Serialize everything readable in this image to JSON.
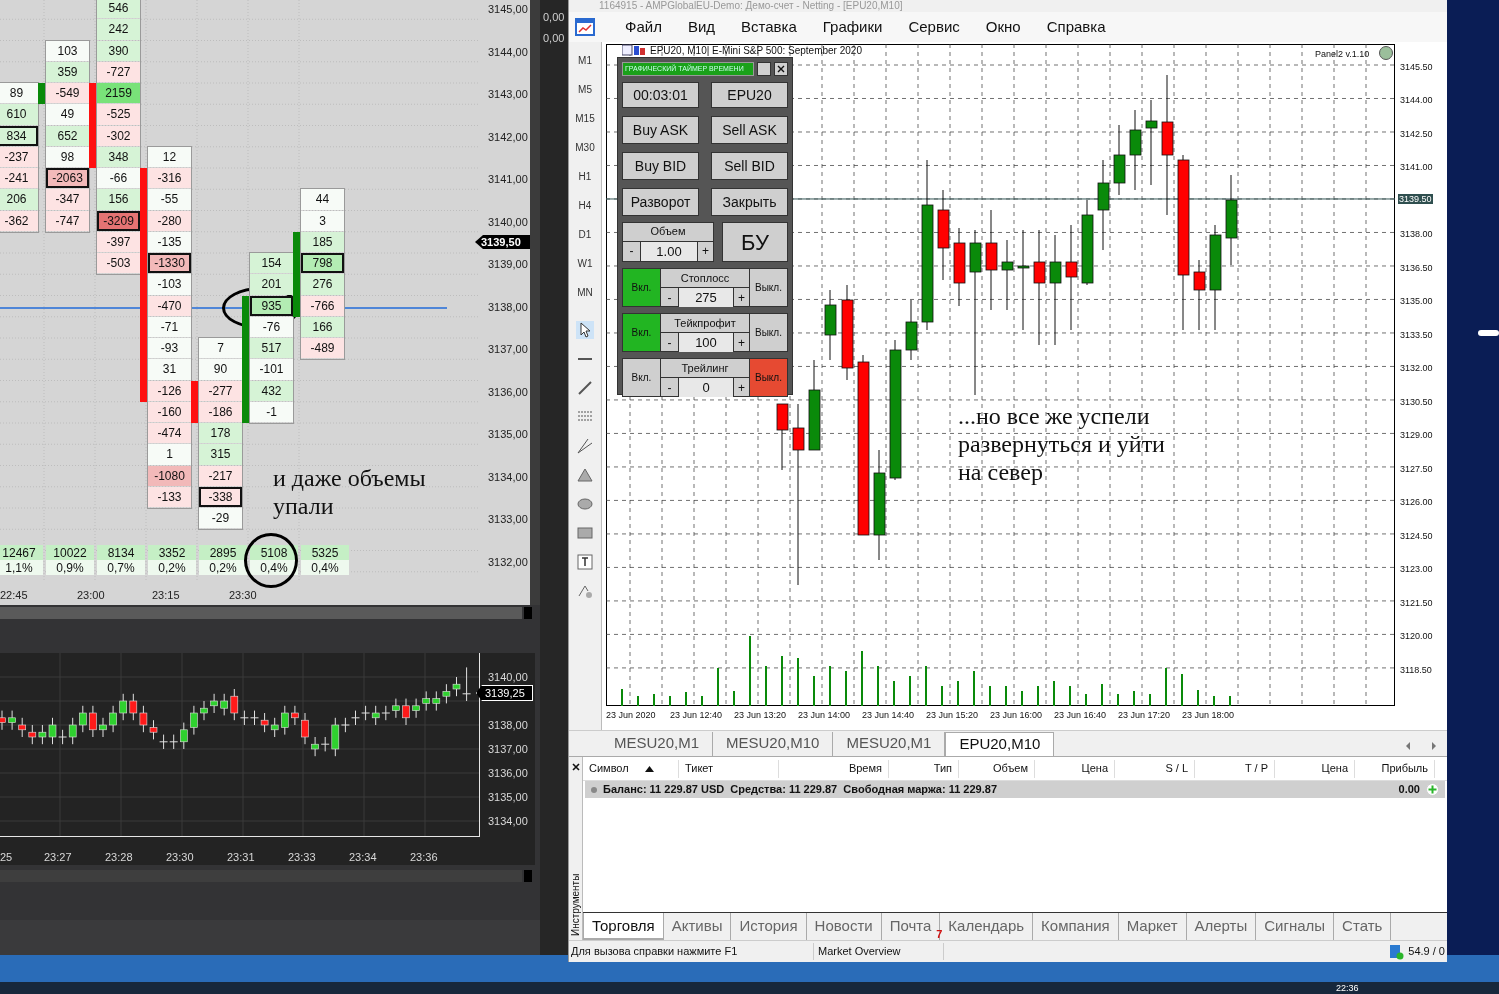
{
  "footprint": {
    "columns": [
      {
        "cells": [
          {
            "value": "89",
            "color": "#f7fbf7",
            "boxed": false,
            "in_body": false
          },
          {
            "value": "610",
            "color": "#d6f3d6",
            "boxed": false,
            "in_body": false
          },
          {
            "value": "834",
            "color": "#d6f3d6",
            "boxed": true,
            "in_body": false
          },
          {
            "value": "-237",
            "color": "#fde3e3",
            "boxed": false,
            "in_body": false
          },
          {
            "value": "-241",
            "color": "#fde3e3",
            "boxed": false,
            "in_body": false
          },
          {
            "value": "206",
            "color": "#d6f3d6",
            "boxed": false,
            "in_body": false
          },
          {
            "value": "-362",
            "color": "#fde3e3",
            "boxed": false,
            "in_body": false
          }
        ],
        "volume": "12467",
        "percent": "1,1%"
      },
      {
        "body": {
          "color": "#0a8a0a"
        },
        "cells": [
          {
            "value": "103",
            "color": "#f7fbf7",
            "boxed": false,
            "in_body": false
          },
          {
            "value": "359",
            "color": "#d6f3d6",
            "boxed": false,
            "in_body": false
          },
          {
            "value": "-549",
            "color": "#fde3e3",
            "boxed": false,
            "in_body": true
          },
          {
            "value": "49",
            "color": "#f7fbf7",
            "boxed": false,
            "in_body": false
          },
          {
            "value": "652",
            "color": "#d6f3d6",
            "boxed": false,
            "in_body": false
          },
          {
            "value": "98",
            "color": "#f7fbf7",
            "boxed": false,
            "in_body": false
          },
          {
            "value": "-2063",
            "color": "#f2b9b9",
            "boxed": true,
            "in_body": false
          },
          {
            "value": "-347",
            "color": "#fde3e3",
            "boxed": false,
            "in_body": false
          },
          {
            "value": "-747",
            "color": "#fde3e3",
            "boxed": false,
            "in_body": false
          }
        ],
        "volume": "10022",
        "percent": "0,9%"
      },
      {
        "body": {
          "color": "#ff1010"
        },
        "cells": [
          {
            "value": "546",
            "color": "#d6f3d6",
            "boxed": false,
            "in_body": false
          },
          {
            "value": "242",
            "color": "#d6f3d6",
            "boxed": false,
            "in_body": false
          },
          {
            "value": "390",
            "color": "#d6f3d6",
            "boxed": false,
            "in_body": false
          },
          {
            "value": "-727",
            "color": "#fde3e3",
            "boxed": false,
            "in_body": false
          },
          {
            "value": "2159",
            "color": "#79e279",
            "boxed": false,
            "in_body": true
          },
          {
            "value": "-525",
            "color": "#fde3e3",
            "boxed": false,
            "in_body": true
          },
          {
            "value": "-302",
            "color": "#fde3e3",
            "boxed": false,
            "in_body": true
          },
          {
            "value": "348",
            "color": "#d6f3d6",
            "boxed": false,
            "in_body": true
          },
          {
            "value": "-66",
            "color": "#f7fbf7",
            "boxed": false,
            "in_body": false
          },
          {
            "value": "156",
            "color": "#d6f3d6",
            "boxed": false,
            "in_body": false
          },
          {
            "value": "-3209",
            "color": "#e57373",
            "boxed": true,
            "in_body": false
          },
          {
            "value": "-397",
            "color": "#fde3e3",
            "boxed": false,
            "in_body": false
          },
          {
            "value": "-503",
            "color": "#fde3e3",
            "boxed": false,
            "in_body": false
          }
        ],
        "volume": "8134",
        "percent": "0,7%"
      },
      {
        "body": {
          "color": "#ff1010"
        },
        "cells": [
          {
            "value": "12",
            "color": "#f7fbf7",
            "boxed": false,
            "in_body": false
          },
          {
            "value": "-316",
            "color": "#fde3e3",
            "boxed": false,
            "in_body": true
          },
          {
            "value": "-55",
            "color": "#f7fbf7",
            "boxed": false,
            "in_body": true
          },
          {
            "value": "-280",
            "color": "#fde3e3",
            "boxed": false,
            "in_body": true
          },
          {
            "value": "-135",
            "color": "#f7fbf7",
            "boxed": false,
            "in_body": true
          },
          {
            "value": "-1330",
            "color": "#f2b9b9",
            "boxed": true,
            "in_body": true
          },
          {
            "value": "-103",
            "color": "#f7fbf7",
            "boxed": false,
            "in_body": true
          },
          {
            "value": "-470",
            "color": "#fde3e3",
            "boxed": false,
            "in_body": true
          },
          {
            "value": "-71",
            "color": "#f7fbf7",
            "boxed": false,
            "in_body": true
          },
          {
            "value": "-93",
            "color": "#f7fbf7",
            "boxed": false,
            "in_body": true
          },
          {
            "value": "31",
            "color": "#f7fbf7",
            "boxed": false,
            "in_body": true
          },
          {
            "value": "-126",
            "color": "#fde3e3",
            "boxed": false,
            "in_body": true
          },
          {
            "value": "-160",
            "color": "#fde3e3",
            "boxed": false,
            "in_body": false
          },
          {
            "value": "-474",
            "color": "#fde3e3",
            "boxed": false,
            "in_body": false
          },
          {
            "value": "1",
            "color": "#f7fbf7",
            "boxed": false,
            "in_body": false
          },
          {
            "value": "-1080",
            "color": "#f2b9b9",
            "boxed": false,
            "in_body": false
          },
          {
            "value": "-133",
            "color": "#fde3e3",
            "boxed": false,
            "in_body": false
          }
        ],
        "volume": "3352",
        "percent": "0,2%"
      },
      {
        "body": {
          "color": "#ff1010"
        },
        "cells": [
          {
            "value": "7",
            "color": "#f7fbf7",
            "boxed": false,
            "in_body": false
          },
          {
            "value": "90",
            "color": "#f7fbf7",
            "boxed": false,
            "in_body": false
          },
          {
            "value": "-277",
            "color": "#fde3e3",
            "boxed": false,
            "in_body": true
          },
          {
            "value": "-186",
            "color": "#fde3e3",
            "boxed": false,
            "in_body": true
          },
          {
            "value": "178",
            "color": "#d6f3d6",
            "boxed": false,
            "in_body": false
          },
          {
            "value": "315",
            "color": "#d6f3d6",
            "boxed": false,
            "in_body": false
          },
          {
            "value": "-217",
            "color": "#fde3e3",
            "boxed": false,
            "in_body": false
          },
          {
            "value": "-338",
            "color": "#fde3e3",
            "boxed": true,
            "in_body": false
          },
          {
            "value": "-29",
            "color": "#f7fbf7",
            "boxed": false,
            "in_body": false
          }
        ],
        "volume": "2895",
        "percent": "0,2%"
      },
      {
        "body": {
          "color": "#0a8a0a"
        },
        "cells": [
          {
            "value": "154",
            "color": "#d6f3d6",
            "boxed": false,
            "in_body": false
          },
          {
            "value": "201",
            "color": "#d6f3d6",
            "boxed": false,
            "in_body": false
          },
          {
            "value": "935",
            "color": "#b3ecb3",
            "boxed": true,
            "in_body": true
          },
          {
            "value": "-76",
            "color": "#f7fbf7",
            "boxed": false,
            "in_body": true
          },
          {
            "value": "517",
            "color": "#d6f3d6",
            "boxed": false,
            "in_body": true
          },
          {
            "value": "-101",
            "color": "#f7fbf7",
            "boxed": false,
            "in_body": true
          },
          {
            "value": "432",
            "color": "#d6f3d6",
            "boxed": false,
            "in_body": true
          },
          {
            "value": "-1",
            "color": "#f7fbf7",
            "boxed": false,
            "in_body": true
          }
        ],
        "volume": "5108",
        "percent": "0,4%"
      },
      {
        "body": {
          "color": "#0a8a0a"
        },
        "cells": [
          {
            "value": "44",
            "color": "#f7fbf7",
            "boxed": false,
            "in_body": false
          },
          {
            "value": "3",
            "color": "#f7fbf7",
            "boxed": false,
            "in_body": false
          },
          {
            "value": "185",
            "color": "#d6f3d6",
            "boxed": false,
            "in_body": true
          },
          {
            "value": "798",
            "color": "#b3ecb3",
            "boxed": true,
            "in_body": true
          },
          {
            "value": "276",
            "color": "#d6f3d6",
            "boxed": false,
            "in_body": true
          },
          {
            "value": "-766",
            "color": "#fde3e3",
            "boxed": false,
            "in_body": true
          },
          {
            "value": "166",
            "color": "#d6f3d6",
            "boxed": false,
            "in_body": false
          },
          {
            "value": "-489",
            "color": "#fde3e3",
            "boxed": false,
            "in_body": false
          }
        ],
        "volume": "5325",
        "percent": "0,4%"
      }
    ],
    "price_axis": [
      "3145,00",
      "3144,00",
      "3143,00",
      "3142,00",
      "3141,00",
      "3140,00",
      "3139,00",
      "3138,00",
      "3137,00",
      "3136,00",
      "3135,00",
      "3134,00",
      "3133,00",
      "3132,00"
    ],
    "current_price": "3139,50",
    "time_axis": [
      "22:45",
      "23:00",
      "23:15",
      "23:30"
    ],
    "annotation": "и даже объемы упали"
  },
  "side_values": [
    "0,00",
    "0,00"
  ],
  "minute_chart": {
    "price_axis": [
      "3140,00",
      "3138,00",
      "3137,00",
      "3136,00",
      "3135,00",
      "3134,00"
    ],
    "current_price": "3139,25",
    "time_axis": [
      "25",
      "23:27",
      "23:28",
      "23:30",
      "23:31",
      "23:33",
      "23:34",
      "23:36"
    ]
  },
  "terminal": {
    "title": "1164915 - AMPGlobalEU-Demo: Демо-счет - Netting - [EPU20,M10]",
    "menu": [
      "Файл",
      "Вид",
      "Вставка",
      "Графики",
      "Сервис",
      "Окно",
      "Справка"
    ],
    "timeframes": [
      "M1",
      "M5",
      "M15",
      "M30",
      "H1",
      "H4",
      "D1",
      "W1",
      "MN"
    ],
    "chart": {
      "title": "EPU20, M10| E-Mini S&P 500: September 2020",
      "indicator_label": "Panel2 v.1.10",
      "price_axis": [
        "3145.50",
        "3144.00",
        "3142.50",
        "3141.00",
        "3138.00",
        "3136.50",
        "3135.00",
        "3133.50",
        "3132.00",
        "3130.50",
        "3129.00",
        "3127.50",
        "3126.00",
        "3124.50",
        "3123.00",
        "3121.50",
        "3120.00",
        "3118.50"
      ],
      "current_price": "3139.50",
      "time_axis": [
        "23 Jun 2020",
        "23 Jun 12:40",
        "23 Jun 13:20",
        "23 Jun 14:00",
        "23 Jun 14:40",
        "23 Jun 15:20",
        "23 Jun 16:00",
        "23 Jun 16:40",
        "23 Jun 17:20",
        "23 Jun 18:00"
      ],
      "annotation": "...но все же успели развернуться и уйти на север"
    },
    "panel": {
      "title": "ГРАФИЧЕСКИЙ ТАЙМЕР ВРЕМЕНИ",
      "timer": "00:03:01",
      "symbol": "EPU20",
      "buttons": [
        "Buy ASK",
        "Sell ASK",
        "Buy BID",
        "Sell BID",
        "Разворот",
        "Закрыть"
      ],
      "volume": {
        "label": "Объем",
        "minus": "-",
        "value": "1.00",
        "plus": "+"
      },
      "breakeven": "БУ",
      "toggles": [
        {
          "label": "Стоплосс",
          "on_label": "Вкл.",
          "off_label": "Выкл.",
          "minus": "-",
          "value": "275",
          "plus": "+",
          "on": true
        },
        {
          "label": "Тейкпрофит",
          "on_label": "Вкл.",
          "off_label": "Выкл.",
          "minus": "-",
          "value": "100",
          "plus": "+",
          "on": true
        },
        {
          "label": "Трейлинг",
          "on_label": "Вкл.",
          "off_label": "Выкл.",
          "minus": "-",
          "value": "0",
          "plus": "+",
          "on": false
        }
      ]
    },
    "chart_tabs": [
      {
        "label": "MESU20,M1",
        "selected": false
      },
      {
        "label": "MESU20,M10",
        "selected": false
      },
      {
        "label": "MESU20,M1",
        "selected": false
      },
      {
        "label": "EPU20,M10",
        "selected": true
      }
    ],
    "table": {
      "columns": [
        "Символ",
        "Тикет",
        "Время",
        "Тип",
        "Объем",
        "Цена",
        "S / L",
        "T / P",
        "Цена",
        "Прибыль"
      ],
      "balance_row": {
        "text": "Баланс: 11 229.87 USD  Средства: 11 229.87  Свободная маржа: 11 229.87",
        "profit": "0.00"
      }
    },
    "side_label": "Инструменты",
    "bottom_tabs": [
      {
        "label": "Торговля",
        "selected": true
      },
      {
        "label": "Активы",
        "selected": false
      },
      {
        "label": "История",
        "selected": false
      },
      {
        "label": "Новости",
        "selected": false
      },
      {
        "label": "Почта",
        "selected": false,
        "badge": "7"
      },
      {
        "label": "Календарь",
        "selected": false
      },
      {
        "label": "Компания",
        "selected": false
      },
      {
        "label": "Маркет",
        "selected": false
      },
      {
        "label": "Алерты",
        "selected": false
      },
      {
        "label": "Сигналы",
        "selected": false
      },
      {
        "label": "Стать",
        "selected": false
      }
    ],
    "status_bar": [
      "Для вызова справки нажмите F1",
      "Market Overview",
      "54.9 / 0"
    ]
  },
  "taskbar": {
    "clock": "22:36"
  }
}
